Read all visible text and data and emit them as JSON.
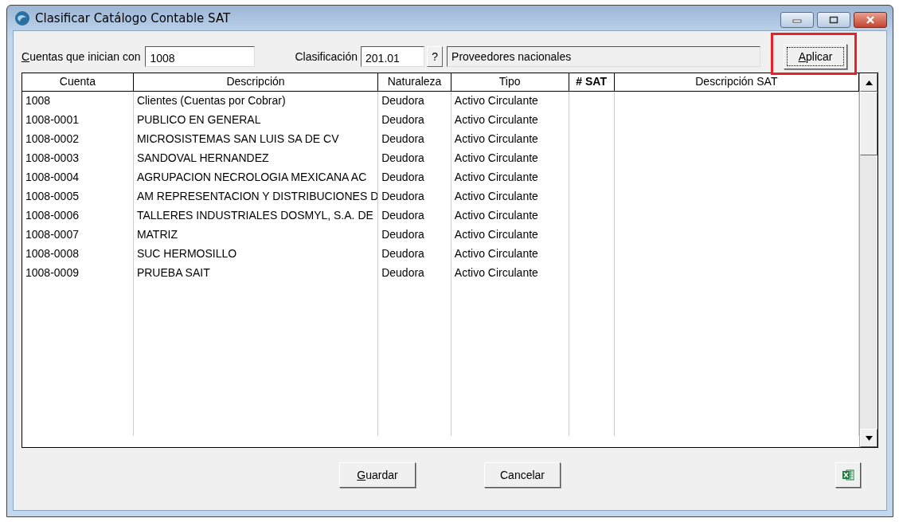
{
  "window": {
    "title": "Clasificar Catálogo Contable SAT"
  },
  "filter": {
    "label": "Cuentas que inician con",
    "value": "1008"
  },
  "classification": {
    "label": "Clasificación",
    "value": "201.01",
    "help": "?",
    "description": "Proveedores nacionales"
  },
  "apply_button": {
    "label": "Aplicar",
    "highlighted": true
  },
  "table": {
    "columns": [
      "Cuenta",
      "Descripción",
      "Naturaleza",
      "Tipo",
      "# SAT",
      "Descripción SAT"
    ],
    "rows": [
      [
        "1008",
        "Clientes (Cuentas por Cobrar)",
        "Deudora",
        "Activo Circulante"
      ],
      [
        "1008-0001",
        "PUBLICO EN GENERAL",
        "Deudora",
        "Activo Circulante"
      ],
      [
        "1008-0002",
        "MICROSISTEMAS SAN LUIS SA DE CV",
        "Deudora",
        "Activo Circulante"
      ],
      [
        "1008-0003",
        "SANDOVAL HERNANDEZ",
        "Deudora",
        "Activo Circulante"
      ],
      [
        "1008-0004",
        "AGRUPACION NECROLOGIA MEXICANA AC",
        "Deudora",
        "Activo Circulante"
      ],
      [
        "1008-0005",
        "AM REPRESENTACION Y DISTRIBUCIONES D",
        "Deudora",
        "Activo Circulante"
      ],
      [
        "1008-0006",
        "TALLERES INDUSTRIALES DOSMYL, S.A. DE",
        "Deudora",
        "Activo Circulante"
      ],
      [
        "1008-0007",
        "MATRIZ",
        "Deudora",
        "Activo Circulante"
      ],
      [
        "1008-0008",
        "SUC HERMOSILLO",
        "Deudora",
        "Activo Circulante"
      ],
      [
        "1008-0009",
        "PRUEBA SAIT",
        "Deudora",
        "Activo Circulante"
      ]
    ]
  },
  "buttons": [
    "Guardar",
    "Cancelar"
  ]
}
